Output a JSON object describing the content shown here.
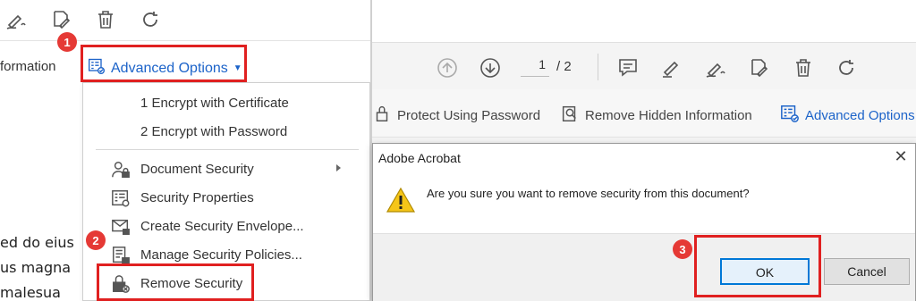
{
  "left": {
    "info_text": "formation",
    "advanced_options_label": "Advanced Options",
    "doc_lines": [
      "ed do eius",
      "us magna",
      "malesua"
    ]
  },
  "menu": {
    "items": [
      {
        "label": "1 Encrypt with Certificate"
      },
      {
        "label": "2 Encrypt with Password"
      },
      {
        "label": "Document Security"
      },
      {
        "label": "Security Properties"
      },
      {
        "label": "Create Security Envelope..."
      },
      {
        "label": "Manage Security Policies..."
      },
      {
        "label": "Remove Security"
      }
    ]
  },
  "right": {
    "page_current": "1",
    "page_total": "/ 2",
    "protect_label": "Protect Using Password",
    "remove_hidden_label": "Remove Hidden Information",
    "advanced_options_label": "Advanced Options"
  },
  "dialog": {
    "title": "Adobe Acrobat",
    "close": "✕",
    "message": "Are you sure you want to remove security from this document?",
    "ok_label": "OK",
    "cancel_label": "Cancel"
  },
  "badges": {
    "step1": "1",
    "step2": "2",
    "step3": "3"
  },
  "colors": {
    "accent_blue": "#1c63c9",
    "highlight_red": "#e02020",
    "badge_red": "#e53935",
    "ok_border": "#0078d7"
  }
}
